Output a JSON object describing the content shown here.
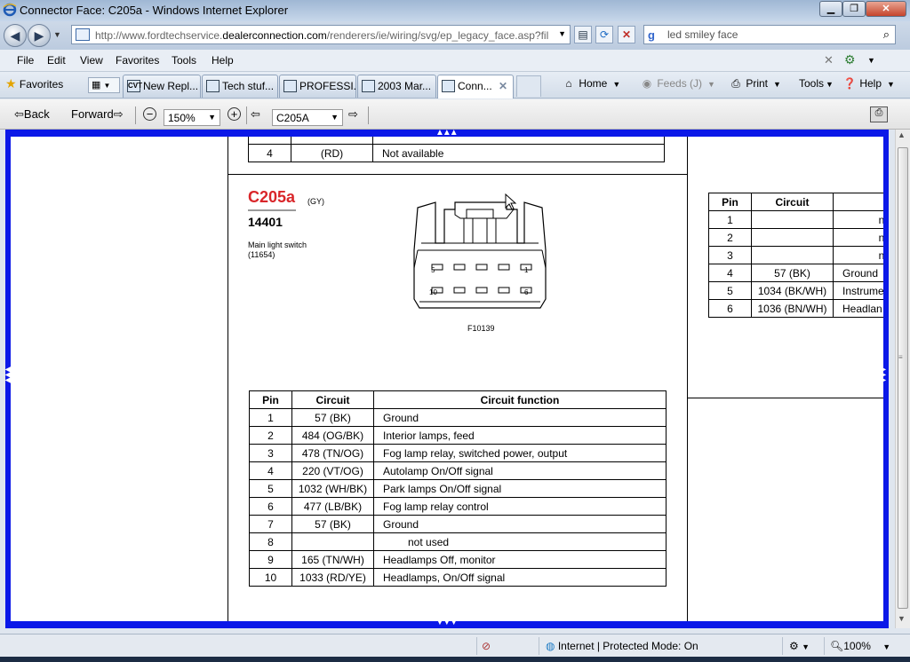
{
  "window": {
    "title": "Connector Face: C205a - Windows Internet Explorer"
  },
  "address": {
    "url_prefix": "http://www.fordtechservice.",
    "url_domain": "dealerconnection.com",
    "url_suffix": "/renderers/ie/wiring/svg/ep_legacy_face.asp?fil"
  },
  "search": {
    "value": "led smiley face"
  },
  "menu": [
    "File",
    "Edit",
    "View",
    "Favorites",
    "Tools",
    "Help"
  ],
  "favorites_label": "Favorites",
  "tabs": [
    {
      "label": "New Repl...",
      "icon": "CVT"
    },
    {
      "label": "Tech stuf..."
    },
    {
      "label": "PROFESSI..."
    },
    {
      "label": "2003 Mar..."
    },
    {
      "label": "Conn..."
    }
  ],
  "commands": {
    "home": "Home",
    "feeds": "Feeds (J)",
    "print": "Print",
    "tools": "Tools",
    "help": "Help"
  },
  "svg_toolbar": {
    "back": "Back",
    "forward": "Forward",
    "zoom": "150%",
    "connector_select": "C205A"
  },
  "connector": {
    "id": "C205a",
    "color": "(GY)",
    "part_number": "14401",
    "description": "Main light switch",
    "code": "(11654)",
    "figure": "F10139",
    "pin_labels": {
      "top_left": "5",
      "top_right": "1",
      "bottom_left": "10",
      "bottom_right": "6"
    }
  },
  "top_table_rows": [
    {
      "pin": "4",
      "circuit": "(RD)",
      "function": "Not available"
    }
  ],
  "main_table": {
    "headers": [
      "Pin",
      "Circuit",
      "Circuit function"
    ],
    "rows": [
      {
        "pin": "1",
        "circuit": "57 (BK)",
        "function": "Ground"
      },
      {
        "pin": "2",
        "circuit": "484 (OG/BK)",
        "function": "Interior lamps, feed"
      },
      {
        "pin": "3",
        "circuit": "478 (TN/OG)",
        "function": "Fog lamp relay, switched power, output"
      },
      {
        "pin": "4",
        "circuit": "220 (VT/OG)",
        "function": "Autolamp On/Off signal"
      },
      {
        "pin": "5",
        "circuit": "1032 (WH/BK)",
        "function": "Park lamps On/Off signal"
      },
      {
        "pin": "6",
        "circuit": "477 (LB/BK)",
        "function": "Fog lamp relay control"
      },
      {
        "pin": "7",
        "circuit": "57 (BK)",
        "function": "Ground"
      },
      {
        "pin": "8",
        "circuit": "",
        "function": "not used"
      },
      {
        "pin": "9",
        "circuit": "165 (TN/WH)",
        "function": "Headlamps Off, monitor"
      },
      {
        "pin": "10",
        "circuit": "1033 (RD/YE)",
        "function": "Headlamps, On/Off signal"
      }
    ]
  },
  "right_table": {
    "headers": [
      "Pin",
      "Circuit"
    ],
    "rows": [
      {
        "pin": "1",
        "circuit": "",
        "function": "no"
      },
      {
        "pin": "2",
        "circuit": "",
        "function": "no"
      },
      {
        "pin": "3",
        "circuit": "",
        "function": "no"
      },
      {
        "pin": "4",
        "circuit": "57 (BK)",
        "function": "Ground"
      },
      {
        "pin": "5",
        "circuit": "1034 (BK/WH)",
        "function": "Instrume"
      },
      {
        "pin": "6",
        "circuit": "1036 (BN/WH)",
        "function": "Headlan"
      }
    ]
  },
  "status": {
    "zone": "Internet | Protected Mode: On",
    "zoom": "100%"
  }
}
